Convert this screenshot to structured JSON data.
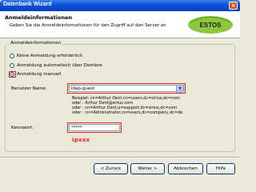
{
  "window": {
    "title": "Datenbank Wizard",
    "close_glyph": "×"
  },
  "header": {
    "title": "Anmeldeinformationen",
    "subtitle": "Geben Sie die Anmeldeinformationen für den Zugriff auf den Server an",
    "logo_text": "ESTOS",
    "logo_color": "#8dc63f"
  },
  "group": {
    "label": "Anmeldeinformationen",
    "options": [
      {
        "label": "Keine Anmeldung erforderlich",
        "checked": false
      },
      {
        "label": "Anmeldung automatisch über Domäne",
        "checked": false
      },
      {
        "label": "Anmeldung manuell",
        "checked": true
      }
    ]
  },
  "username": {
    "label": "Benutzer Name:",
    "value": "ldap-guest",
    "arrow_glyph": "▼"
  },
  "examples": [
    "Beispiel: cn=Arthur Dent,cn=users,dc=sirius,dc=com",
    "oder : Arthur Dent@sirius.com",
    "oder : cn=Arthur Dent,o=support,dc=sirius,dc=com",
    "oder : cn=Administrator,cn=users,dc=company,dc=de"
  ],
  "password": {
    "label": "Kennwort:",
    "value": "*****"
  },
  "annotation": "ipxxx",
  "buttons": {
    "back": "< Zurück",
    "next": "Weiter >",
    "cancel": "Abbrechen",
    "help": "Hilfe"
  },
  "colors": {
    "highlight": "#e8222c",
    "titlebar": "#0a4ed8"
  }
}
